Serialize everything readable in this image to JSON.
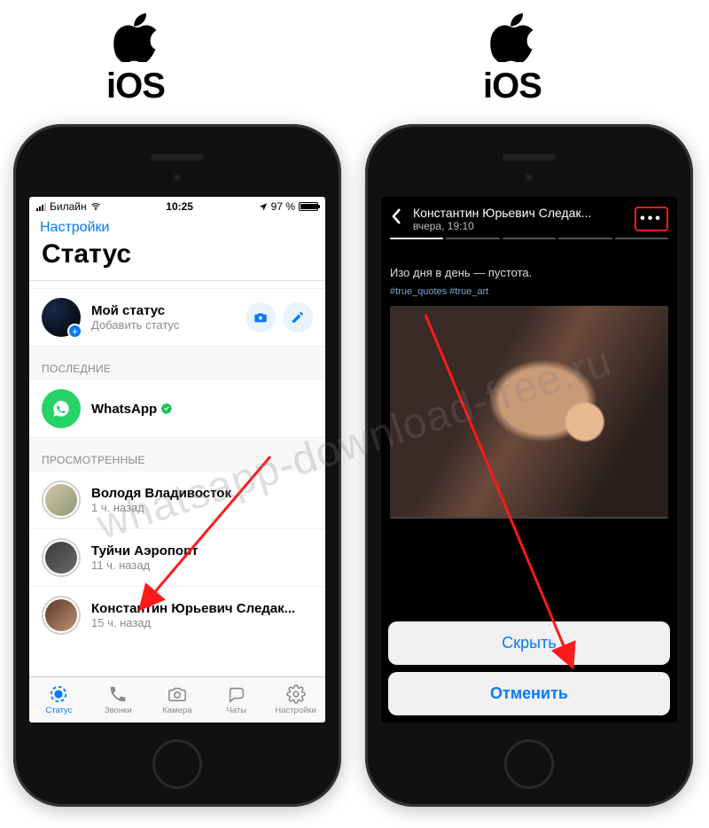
{
  "os_label": "iOS",
  "watermark": "whatsapp-download-free.ru",
  "left_screen": {
    "status_bar": {
      "carrier": "Билайн",
      "time": "10:25",
      "battery": "97 %"
    },
    "nav_link": "Настройки",
    "title": "Статус",
    "my_status": {
      "title": "Мой статус",
      "subtitle": "Добавить статус"
    },
    "section_recent": "ПОСЛЕДНИЕ",
    "whatsapp_row": {
      "title": "WhatsApp"
    },
    "section_viewed": "ПРОСМОТРЕННЫЕ",
    "viewed": [
      {
        "name": "Володя Владивосток",
        "time": "1 ч. назад"
      },
      {
        "name": "Туйчи Аэропорт",
        "time": "11 ч. назад"
      },
      {
        "name": "Константин Юрьевич Следак...",
        "time": "15 ч. назад"
      }
    ],
    "tabs": {
      "status": "Статус",
      "calls": "Звонки",
      "camera": "Камера",
      "chats": "Чаты",
      "settings": "Настройки"
    }
  },
  "right_screen": {
    "header": {
      "name": "Константин Юрьевич Следак...",
      "time": "вчера, 19:10"
    },
    "caption": "Изо дня в день — пустота.",
    "tags": "#true_quotes #true_art",
    "sheet": {
      "hide": "Скрыть",
      "cancel": "Отменить"
    }
  }
}
